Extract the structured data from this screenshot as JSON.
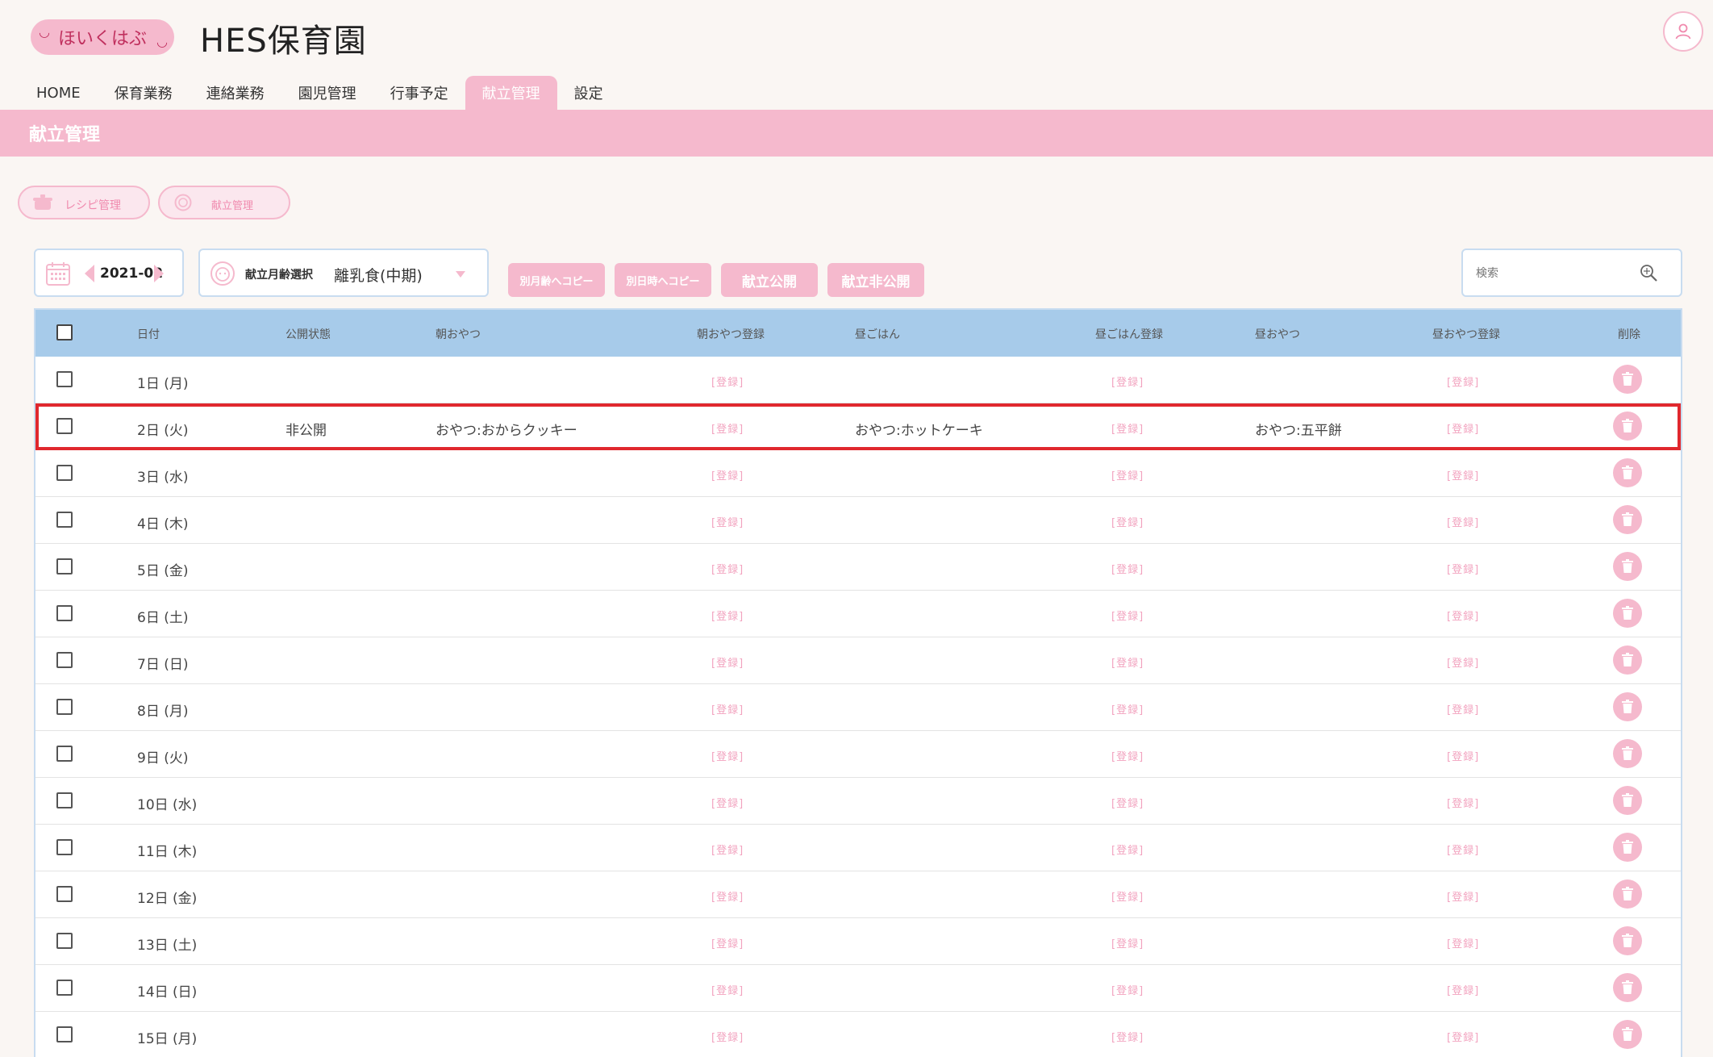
{
  "header": {
    "logo_text": "ほいくはぶ",
    "site_title": "HES保育園"
  },
  "nav": {
    "tabs": [
      {
        "label": "HOME"
      },
      {
        "label": "保育業務"
      },
      {
        "label": "連絡業務"
      },
      {
        "label": "園児管理"
      },
      {
        "label": "行事予定"
      },
      {
        "label": "献立管理",
        "active": true
      },
      {
        "label": "設定"
      }
    ]
  },
  "banner": {
    "title": "献立管理"
  },
  "subnav": {
    "recipe": "レシピ管理",
    "menu": "献立管理"
  },
  "controls": {
    "month": "2021-02",
    "age_label": "献立月齢選択",
    "age_value": "離乳食(中期)",
    "copy_other_age": "別月齢へコピー",
    "copy_other_time": "別日時へコピー",
    "publish": "献立公開",
    "unpublish": "献立非公開",
    "search_placeholder": "検索"
  },
  "table": {
    "headers": {
      "date": "日付",
      "status": "公開状態",
      "morning_snack": "朝おやつ",
      "morning_snack_reg": "朝おやつ登録",
      "lunch": "昼ごはん",
      "lunch_reg": "昼ごはん登録",
      "afternoon_snack": "昼おやつ",
      "afternoon_snack_reg": "昼おやつ登録",
      "delete": "削除"
    },
    "register_label": "[登録]",
    "rows": [
      {
        "date": "1日 (月)",
        "status": "",
        "morning": "",
        "lunch": "",
        "afternoon": ""
      },
      {
        "date": "2日 (火)",
        "status": "非公開",
        "morning": "おやつ:おからクッキー",
        "lunch": "おやつ:ホットケーキ",
        "afternoon": "おやつ:五平餅",
        "highlighted": true
      },
      {
        "date": "3日 (水)",
        "status": "",
        "morning": "",
        "lunch": "",
        "afternoon": ""
      },
      {
        "date": "4日 (木)",
        "status": "",
        "morning": "",
        "lunch": "",
        "afternoon": ""
      },
      {
        "date": "5日 (金)",
        "status": "",
        "morning": "",
        "lunch": "",
        "afternoon": ""
      },
      {
        "date": "6日 (土)",
        "status": "",
        "morning": "",
        "lunch": "",
        "afternoon": ""
      },
      {
        "date": "7日 (日)",
        "status": "",
        "morning": "",
        "lunch": "",
        "afternoon": ""
      },
      {
        "date": "8日 (月)",
        "status": "",
        "morning": "",
        "lunch": "",
        "afternoon": ""
      },
      {
        "date": "9日 (火)",
        "status": "",
        "morning": "",
        "lunch": "",
        "afternoon": ""
      },
      {
        "date": "10日 (水)",
        "status": "",
        "morning": "",
        "lunch": "",
        "afternoon": ""
      },
      {
        "date": "11日 (木)",
        "status": "",
        "morning": "",
        "lunch": "",
        "afternoon": ""
      },
      {
        "date": "12日 (金)",
        "status": "",
        "morning": "",
        "lunch": "",
        "afternoon": ""
      },
      {
        "date": "13日 (土)",
        "status": "",
        "morning": "",
        "lunch": "",
        "afternoon": ""
      },
      {
        "date": "14日 (日)",
        "status": "",
        "morning": "",
        "lunch": "",
        "afternoon": ""
      },
      {
        "date": "15日 (月)",
        "status": "",
        "morning": "",
        "lunch": "",
        "afternoon": ""
      }
    ]
  },
  "colors": {
    "accent_pink": "#f5b9cd",
    "header_blue": "#a7cbea",
    "highlight_red": "#e0282e",
    "background": "#faf6f3"
  }
}
